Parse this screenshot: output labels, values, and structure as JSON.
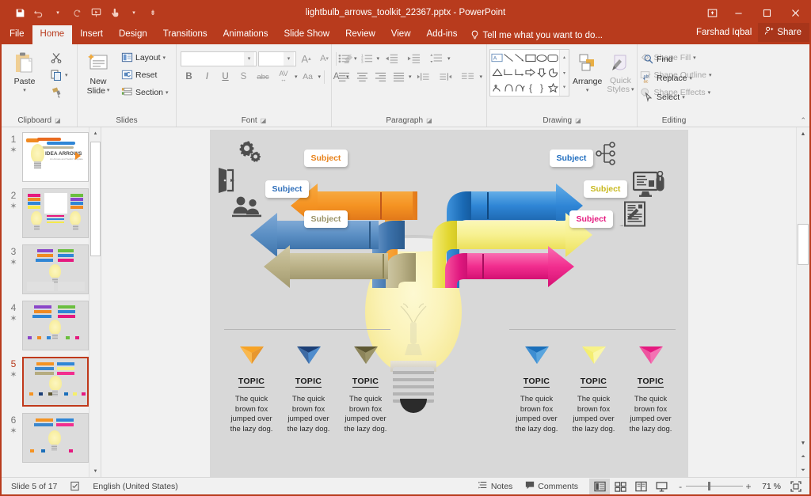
{
  "titlebar": {
    "document_title": "lightbulb_arrows_toolkit_22367.pptx - PowerPoint",
    "qat": [
      {
        "name": "save",
        "label": "Save"
      },
      {
        "name": "undo",
        "label": "Undo"
      },
      {
        "name": "redo",
        "label": "Redo"
      },
      {
        "name": "start-from-beginning",
        "label": "Start From Beginning"
      },
      {
        "name": "touch-mouse-mode",
        "label": "Touch/Mouse Mode"
      },
      {
        "name": "customize-quick-access-toolbar",
        "label": "Customize Quick Access Toolbar"
      }
    ],
    "window_controls": [
      {
        "name": "ribbon-display-options",
        "label": "Ribbon Display Options"
      },
      {
        "name": "minimize",
        "label": "Minimize"
      },
      {
        "name": "restore",
        "label": "Restore Down"
      },
      {
        "name": "close",
        "label": "Close"
      }
    ]
  },
  "tabs": [
    {
      "label": "File",
      "active": false
    },
    {
      "label": "Home",
      "active": true
    },
    {
      "label": "Insert",
      "active": false
    },
    {
      "label": "Design",
      "active": false
    },
    {
      "label": "Transitions",
      "active": false
    },
    {
      "label": "Animations",
      "active": false
    },
    {
      "label": "Slide Show",
      "active": false
    },
    {
      "label": "Review",
      "active": false
    },
    {
      "label": "View",
      "active": false
    },
    {
      "label": "Add-ins",
      "active": false
    }
  ],
  "tell_me": "Tell me what you want to do...",
  "account": {
    "user_name": "Farshad Iqbal",
    "share_label": "Share"
  },
  "ribbon": {
    "groups": [
      {
        "name": "clipboard",
        "label": "Clipboard"
      },
      {
        "name": "slides",
        "label": "Slides"
      },
      {
        "name": "font",
        "label": "Font"
      },
      {
        "name": "paragraph",
        "label": "Paragraph"
      },
      {
        "name": "drawing",
        "label": "Drawing"
      },
      {
        "name": "editing",
        "label": "Editing"
      }
    ],
    "clipboard": {
      "paste_label": "Paste",
      "cut_label": "Cut",
      "copy_label": "Copy",
      "format_painter_label": "Format Painter"
    },
    "slides": {
      "new_slide_label": "New\nSlide",
      "new_slide_line1": "New",
      "new_slide_line2": "Slide",
      "layout_label": "Layout",
      "reset_label": "Reset",
      "section_label": "Section"
    },
    "font": {
      "font_name_value": "",
      "font_size_value": "",
      "grow_font_label": "A",
      "shrink_font_label": "A",
      "clear_formatting_label": "Clear All Formatting",
      "bold_label": "B",
      "italic_label": "I",
      "underline_label": "U",
      "shadow_label": "S",
      "strikethrough_label": "abc",
      "spacing_label": "AV",
      "change_case_label": "Aa",
      "font_color_label": "A"
    },
    "drawing": {
      "arrange_label": "Arrange",
      "quick_styles_line1": "Quick",
      "quick_styles_line2": "Styles",
      "shape_fill_label": "Shape Fill",
      "shape_outline_label": "Shape Outline",
      "shape_effects_label": "Shape Effects"
    },
    "editing": {
      "find_label": "Find",
      "replace_label": "Replace",
      "select_label": "Select"
    }
  },
  "thumbnails": [
    {
      "number": "1",
      "selected": false
    },
    {
      "number": "2",
      "selected": false
    },
    {
      "number": "3",
      "selected": false
    },
    {
      "number": "4",
      "selected": false
    },
    {
      "number": "5",
      "selected": true
    },
    {
      "number": "6",
      "selected": false
    }
  ],
  "slide": {
    "subject_labels": [
      {
        "id": "left-top",
        "text": "Subject",
        "color": "#e8821a"
      },
      {
        "id": "left-mid",
        "text": "Subject",
        "color": "#2f6fba"
      },
      {
        "id": "left-bottom",
        "text": "Subject",
        "color": "#9b9469"
      },
      {
        "id": "right-top",
        "text": "Subject",
        "color": "#1f6dbf"
      },
      {
        "id": "right-mid",
        "text": "Subject",
        "color": "#c8b91e"
      },
      {
        "id": "right-bottom",
        "text": "Subject",
        "color": "#e5197f"
      }
    ],
    "icons": [
      {
        "name": "gears-icon",
        "side": "left"
      },
      {
        "name": "door-exit-icon",
        "side": "left"
      },
      {
        "name": "people-group-icon",
        "side": "left"
      },
      {
        "name": "hierarchy-node-icon",
        "side": "right"
      },
      {
        "name": "monitor-mouse-icon",
        "side": "right"
      },
      {
        "name": "document-pen-icon",
        "side": "right"
      }
    ],
    "arrow_colors": [
      "#f59322",
      "#3b87cd",
      "#b5ac80",
      "#2f86d6",
      "#f5ef85",
      "#f22e8f"
    ],
    "topics": [
      {
        "title": "TOPIC",
        "body": "The quick brown fox jumped over the lazy dog.",
        "color_top": "#f7a325",
        "color_bottom": "#ea8c12"
      },
      {
        "title": "TOPIC",
        "body": "The quick brown fox jumped over the lazy dog.",
        "color_top": "#1c3f76",
        "color_bottom": "#3f7cc4"
      },
      {
        "title": "TOPIC",
        "body": "The quick brown fox jumped over the lazy dog.",
        "color_top": "#5e5833",
        "color_bottom": "#9b9469"
      },
      {
        "title": "TOPIC",
        "body": "The quick brown fox jumped over the lazy dog.",
        "color_top": "#1b6fba",
        "color_bottom": "#4a9ad8"
      },
      {
        "title": "TOPIC",
        "body": "The quick brown fox jumped over the lazy dog.",
        "color_top": "#f7f288",
        "color_bottom": "#f5ef6b"
      },
      {
        "title": "TOPIC",
        "body": "The quick brown fox jumped over the lazy dog.",
        "color_top": "#e5197f",
        "color_bottom": "#f45ca8"
      }
    ]
  },
  "statusbar": {
    "slide_indicator": "Slide 5 of 17",
    "language": "English (United States)",
    "notes_label": "Notes",
    "comments_label": "Comments",
    "views": [
      {
        "name": "normal-view",
        "active": true
      },
      {
        "name": "slide-sorter-view",
        "active": false
      },
      {
        "name": "reading-view",
        "active": false
      },
      {
        "name": "slide-show-view",
        "active": false
      }
    ],
    "zoom_out_label": "-",
    "zoom_in_label": "+",
    "zoom_level": "71 %",
    "fit_label": "Fit slide to current window"
  },
  "colors": {
    "brand": "#b83b1d",
    "ribbon_bg": "#f1f1f1",
    "slide_bg": "#d8d8d8"
  }
}
